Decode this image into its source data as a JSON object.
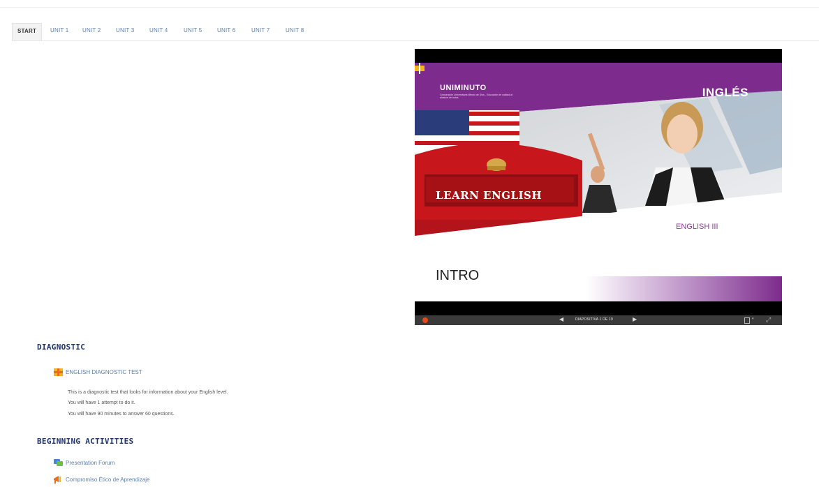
{
  "tabs": [
    {
      "label": "START",
      "active": true
    },
    {
      "label": "UNIT 1"
    },
    {
      "label": "UNIT 2"
    },
    {
      "label": "UNIT 3"
    },
    {
      "label": "UNIT 4"
    },
    {
      "label": "UNIT 5"
    },
    {
      "label": "UNIT 6"
    },
    {
      "label": "UNIT 7"
    },
    {
      "label": "UNIT 8"
    }
  ],
  "slideshow": {
    "logo": "UNIMINUTO",
    "logo_tagline": "Corporación Universitaria Minuto de Dios - Educación de calidad al alcance de todos",
    "title": "INGLÉS",
    "phone_box_text": "LEARN ENGLISH",
    "course": "ENGLISH III",
    "slide_title": "INTRO",
    "controls": {
      "slide_counter": "DIAPOSITIVA 1 DE 19",
      "prev_icon": "triangle-left-icon",
      "next_icon": "triangle-right-icon",
      "fullscreen_icon": "fullscreen-icon",
      "menu_icon": "slide-menu-icon"
    },
    "colors": {
      "purple": "#7d2b8c",
      "phone_red": "#c8161d",
      "control_bar": "#3a3a3a"
    }
  },
  "sections": [
    {
      "title": "DIAGNOSTIC",
      "activities": [
        {
          "label": "ENGLISH DIAGNOSTIC TEST",
          "icon": "quiz-icon"
        }
      ],
      "description": [
        "This is a diagnostic test that looks for information about your English level.",
        "You will have 1 attempt to do it.",
        "You will have 90 minutes to answer 60 questions."
      ]
    },
    {
      "title": "BEGINNING ACTIVITIES",
      "activities": [
        {
          "label": "Presentation Forum",
          "icon": "forum-icon"
        },
        {
          "label": "Compromiso Ético de Aprendizaje",
          "icon": "feedback-icon"
        }
      ]
    }
  ]
}
